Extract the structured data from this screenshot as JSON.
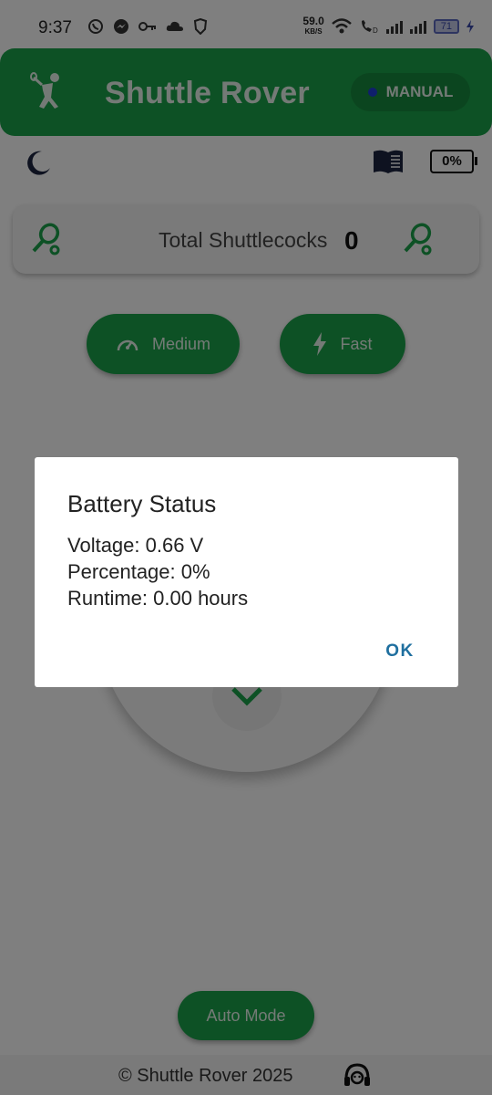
{
  "status_bar": {
    "time": "9:37",
    "net_speed_value": "59.0",
    "net_speed_unit": "KB/S",
    "battery_level": "71"
  },
  "header": {
    "title": "Shuttle Rover",
    "mode_label": "MANUAL"
  },
  "battery_widget": {
    "percent": "0%"
  },
  "counter": {
    "label": "Total Shuttlecocks",
    "value": "0"
  },
  "speed_buttons": [
    {
      "label": "Medium",
      "icon": "speedometer-icon"
    },
    {
      "label": "Fast",
      "icon": "lightning-icon"
    }
  ],
  "auto_mode": {
    "label": "Auto Mode"
  },
  "footer": {
    "text": "© Shuttle Rover 2025"
  },
  "dialog": {
    "title": "Battery Status",
    "voltage": "Voltage: 0.66 V",
    "percentage": "Percentage: 0%",
    "runtime": "Runtime: 0.00 hours",
    "ok_label": "OK"
  },
  "colors": {
    "brand_green": "#1ba34a",
    "dialog_button": "#1f6f9f",
    "mode_dot": "#1e3fd6"
  }
}
